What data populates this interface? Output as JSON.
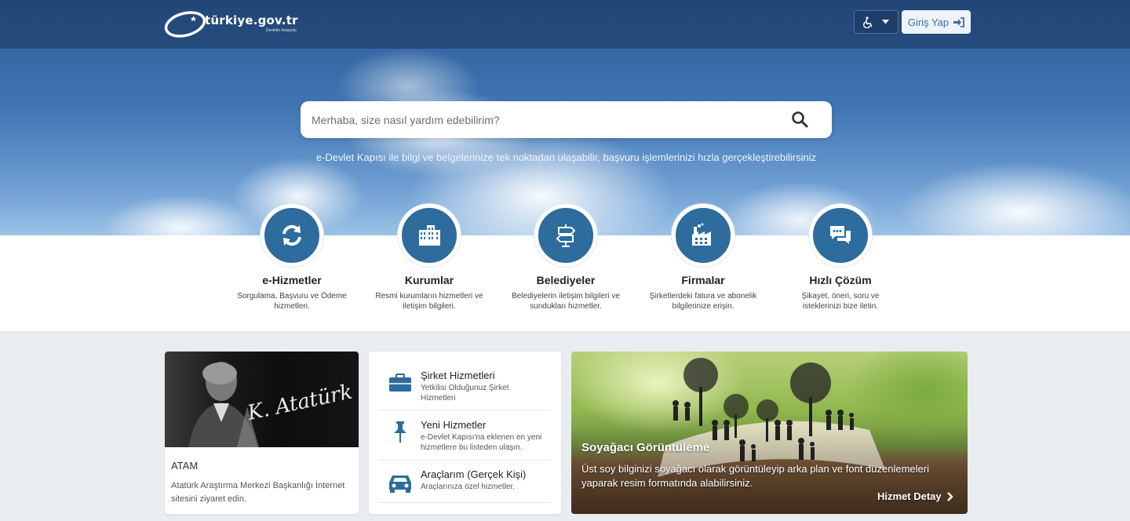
{
  "header": {
    "logo_text": "türkiye.gov.tr",
    "logo_subtext": "Devletin Kısayolu",
    "accessibility_icon": "wheelchair-icon",
    "login_label": "Giriş Yap",
    "login_icon": "sign-in-icon"
  },
  "search": {
    "placeholder": "Merhaba, size nasıl yardım edebilirim?",
    "icon": "search-icon"
  },
  "hero": {
    "tagline": "e-Devlet Kapısı ile bilgi ve belgelerinize tek noktadan ulaşabilir, başvuru işlemlerinizi hızla gerçekleştirebilirsiniz"
  },
  "categories": [
    {
      "title": "e-Hizmetler",
      "desc": "Sorgulama, Başvuru ve Ödeme hizmetleri.",
      "icon": "refresh-icon"
    },
    {
      "title": "Kurumlar",
      "desc": "Resmi kurumların hizmetleri ve iletişim bilgileri.",
      "icon": "building-icon"
    },
    {
      "title": "Belediyeler",
      "desc": "Belediyelerin iletişim bilgileri ve sundukları hizmetler.",
      "icon": "signpost-icon"
    },
    {
      "title": "Firmalar",
      "desc": "Şirketlerdeki fatura ve abonelik bilgilerinize erişin.",
      "icon": "factory-icon"
    },
    {
      "title": "Hızlı Çözüm",
      "desc": "Şikayet, öneri, soru ve isteklerinizi bize iletin.",
      "icon": "chat-icon"
    }
  ],
  "atam_card": {
    "signature": "K. Atatürk",
    "title": "ATAM",
    "desc": "Atatürk Araştırma Merkezi Başkanlığı İnternet sitesini ziyaret edin."
  },
  "services": [
    {
      "title": "Şirket Hizmetleri",
      "desc": "Yetkilisi Olduğunuz Şirket Hizmetleri",
      "icon": "briefcase-icon"
    },
    {
      "title": "Yeni Hizmetler",
      "desc": "e-Devlet Kapısı'na eklenen en yeni hizmetlere bu listeden ulaşın.",
      "icon": "pin-icon"
    },
    {
      "title": "Araçlarım (Gerçek Kişi)",
      "desc": "Araçlarınıza özel hizmetler.",
      "icon": "car-icon"
    }
  ],
  "feature": {
    "title": "Soyağacı Görüntüleme",
    "desc": "Üst soy bilginizi soyağacı olarak görüntüleyip arka plan ve font düzenlemeleri yaparak resim formatında alabilirsiniz.",
    "link": "Hizmet Detay"
  },
  "colors": {
    "brand_blue": "#2d6c9c",
    "login_text": "#3a6fa8"
  }
}
